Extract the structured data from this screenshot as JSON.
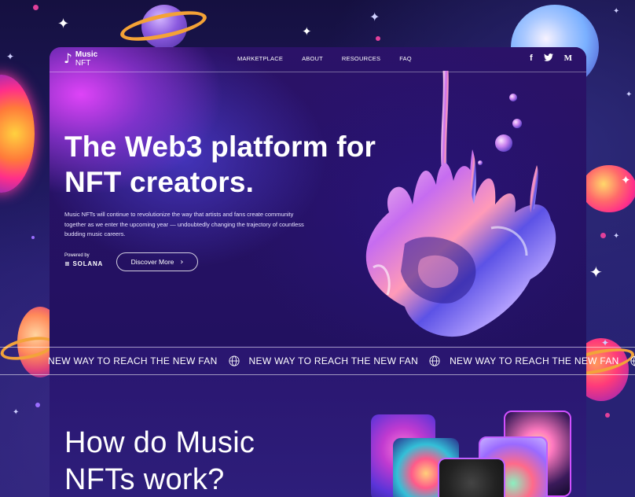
{
  "nav": {
    "logo_line1": "Music",
    "logo_line2": "NFT",
    "menu": [
      "MARKETPLACE",
      "ABOUT",
      "RESOURCES",
      "FAQ"
    ],
    "social": {
      "facebook": "f",
      "twitter": "t",
      "medium": "M"
    }
  },
  "hero": {
    "title_line1": "The Web3 platform for",
    "title_line2": "NFT creators.",
    "paragraph": "Music NFTs will continue to revolutionize the way that artists and fans create community together as we enter the upcoming year — undoubtedly changing the trajectory of countless budding music careers.",
    "powered_by": "Powered by",
    "powered_brand": "SOLANA",
    "cta_label": "Discover More"
  },
  "marquee": {
    "items": [
      "NEW WAY TO REACH THE NEW FAN",
      "NEW WAY TO REACH THE NEW FAN",
      "NEW WAY TO REACH THE NEW FAN"
    ]
  },
  "section": {
    "heading_line1": "How do Music",
    "heading_line2": "NFTs work?"
  },
  "icons": {
    "logo": "music-note-icon",
    "facebook": "facebook-icon",
    "twitter": "twitter-icon",
    "medium": "medium-icon",
    "cta_arrow": "chevron-right-icon",
    "marquee": "globe-icon"
  },
  "colors": {
    "background": "#1f1b62",
    "accent_pink": "#e846ff",
    "card": "#2a1466"
  }
}
